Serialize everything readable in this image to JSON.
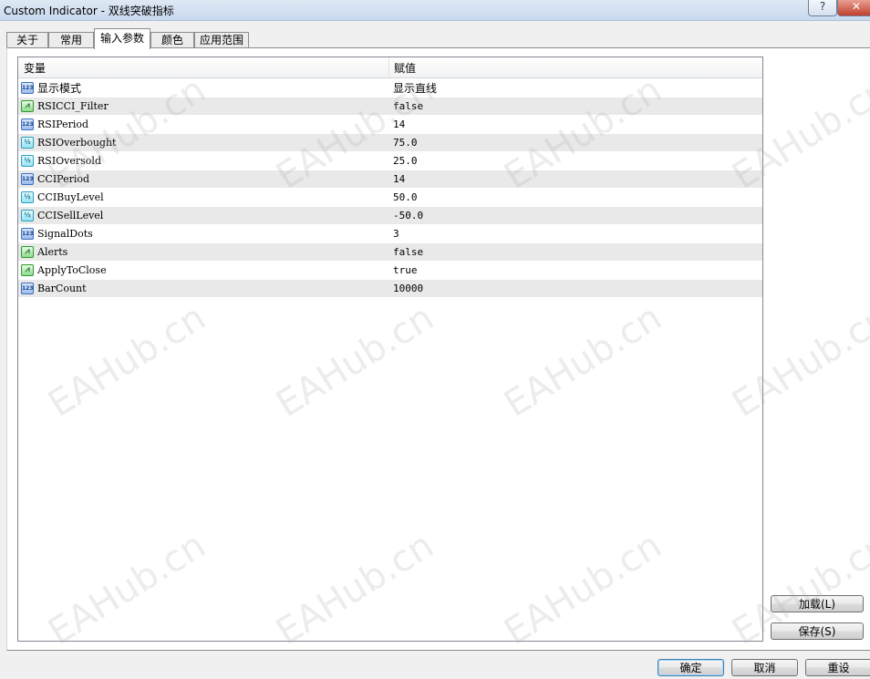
{
  "window": {
    "title": "Custom Indicator - 双线突破指标",
    "help_label": "?",
    "close_label": "✕"
  },
  "tabs": [
    {
      "label": "关于",
      "active": false
    },
    {
      "label": "常用",
      "active": false
    },
    {
      "label": "输入参数",
      "active": true
    },
    {
      "label": "颜色",
      "active": false
    },
    {
      "label": "应用范围",
      "active": false
    }
  ],
  "table": {
    "columns": [
      "变量",
      "赋值"
    ],
    "rows": [
      {
        "icon": "int-icon",
        "icon_text": "123",
        "name": "显示模式",
        "value": "显示直线"
      },
      {
        "icon": "bool-icon",
        "icon_text": "⩘",
        "name": "RSICCI_Filter",
        "value": "false"
      },
      {
        "icon": "int-icon",
        "icon_text": "123",
        "name": "RSIPeriod",
        "value": "14"
      },
      {
        "icon": "double-icon",
        "icon_text": "½",
        "name": "RSIOverbought",
        "value": "75.0"
      },
      {
        "icon": "double-icon",
        "icon_text": "½",
        "name": "RSIOversold",
        "value": "25.0"
      },
      {
        "icon": "int-icon",
        "icon_text": "123",
        "name": "CCIPeriod",
        "value": "14"
      },
      {
        "icon": "double-icon",
        "icon_text": "½",
        "name": "CCIBuyLevel",
        "value": "50.0"
      },
      {
        "icon": "double-icon",
        "icon_text": "½",
        "name": "CCISellLevel",
        "value": "-50.0"
      },
      {
        "icon": "int-icon",
        "icon_text": "123",
        "name": "SignalDots",
        "value": "3"
      },
      {
        "icon": "bool-icon",
        "icon_text": "⩘",
        "name": "Alerts",
        "value": "false"
      },
      {
        "icon": "bool-icon",
        "icon_text": "⩘",
        "name": "ApplyToClose",
        "value": "true"
      },
      {
        "icon": "int-icon",
        "icon_text": "123",
        "name": "BarCount",
        "value": "10000"
      }
    ]
  },
  "side_buttons": {
    "load_label": "加载(L)",
    "save_label": "保存(S)"
  },
  "footer_buttons": {
    "ok_label": "确定",
    "cancel_label": "取消",
    "reset_label": "重设"
  },
  "watermark": {
    "text": "EAHub.cn"
  },
  "colors": {
    "alt_row": "#e9e9e9",
    "title_bar": "#c9d9ee",
    "close_button": "#c0402c"
  }
}
